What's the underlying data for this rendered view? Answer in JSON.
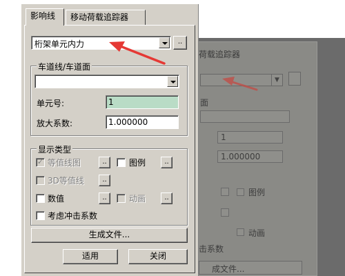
{
  "ghost": {
    "tab_label": "荷载追踪器",
    "group_fragment": "面",
    "unit_value": "1",
    "scale_value": "1.000000",
    "legend_label": "图例",
    "animation_label": "动画",
    "coeff_fragment": "击系数",
    "generate_fragment": "成文件..."
  },
  "tabs": [
    {
      "label": "影响线"
    },
    {
      "label": "移动荷载追踪器"
    }
  ],
  "result_type": {
    "value": "桁架单元内力",
    "more_label": ".."
  },
  "lane_group": {
    "legend": "车道线/车道面",
    "lane_value": "",
    "unit_label": "单元号:",
    "unit_value": "1",
    "scale_label": "放大系数:",
    "scale_value": "1.000000"
  },
  "display_group": {
    "legend": "显示类型",
    "contour_label": "等值线图",
    "contour3d_label": "3D等值线",
    "legend_label": "图例",
    "numeric_label": "数值",
    "animation_label": "动画",
    "impact_label": "考虑冲击系数",
    "more_label": ".."
  },
  "buttons": {
    "generate": "生成文件...",
    "apply": "适用",
    "close": "关闭"
  },
  "colors": {
    "annotation_arrow": "#e53935",
    "unit_field_bg": "#b9dcc6"
  }
}
